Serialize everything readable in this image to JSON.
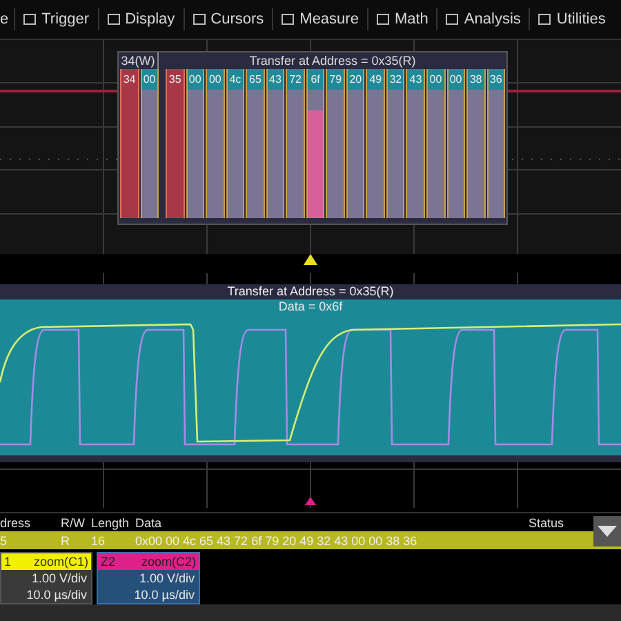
{
  "menu": [
    {
      "label": "e",
      "cut": true
    },
    {
      "label": "Trigger"
    },
    {
      "label": "Display"
    },
    {
      "label": "Cursors"
    },
    {
      "label": "Measure"
    },
    {
      "label": "Math"
    },
    {
      "label": "Analysis"
    },
    {
      "label": "Utilities"
    }
  ],
  "decode_overview": {
    "write_label": "34(W)",
    "read_label": "Transfer at Address = 0x35(R)",
    "bytes": [
      {
        "text": "34",
        "kind": "address",
        "selected": false
      },
      {
        "text": "00",
        "kind": "data",
        "selected": false
      },
      {
        "text": "35",
        "kind": "address",
        "selected": false
      },
      {
        "text": "00",
        "kind": "data",
        "selected": false
      },
      {
        "text": "00",
        "kind": "data",
        "selected": false
      },
      {
        "text": "4c",
        "kind": "data",
        "selected": false
      },
      {
        "text": "65",
        "kind": "data",
        "selected": false
      },
      {
        "text": "43",
        "kind": "data",
        "selected": false
      },
      {
        "text": "72",
        "kind": "data",
        "selected": false
      },
      {
        "text": "6f",
        "kind": "data",
        "selected": true
      },
      {
        "text": "79",
        "kind": "data",
        "selected": false
      },
      {
        "text": "20",
        "kind": "data",
        "selected": false
      },
      {
        "text": "49",
        "kind": "data",
        "selected": false
      },
      {
        "text": "32",
        "kind": "data",
        "selected": false
      },
      {
        "text": "43",
        "kind": "data",
        "selected": false
      },
      {
        "text": "00",
        "kind": "data",
        "selected": false
      },
      {
        "text": "00",
        "kind": "data",
        "selected": false
      },
      {
        "text": "38",
        "kind": "data",
        "selected": false
      },
      {
        "text": "36",
        "kind": "data",
        "selected": false
      }
    ]
  },
  "zoom_view": {
    "title": "Transfer at Address = 0x35(R)",
    "data_label": "Data = 0x6f"
  },
  "table": {
    "columns": [
      "dress",
      "R/W",
      "Length",
      "Data",
      "Status"
    ],
    "rows": [
      {
        "cells": [
          "5",
          "R",
          "16",
          "0x00 00 4c 65 43 72 6f 79 20 49 32 43 00 00 38 36",
          ""
        ],
        "selected": true
      }
    ]
  },
  "traces": [
    {
      "name": "1",
      "source": "zoom(C1)",
      "color": "#f0f000",
      "vdiv": "1.00 V/div",
      "tdiv": "10.0 µs/div"
    },
    {
      "name": "Z2",
      "source": "zoom(C2)",
      "color": "#e0208a",
      "vdiv": "1.00 V/div",
      "tdiv": "10.0 µs/div"
    }
  ]
}
